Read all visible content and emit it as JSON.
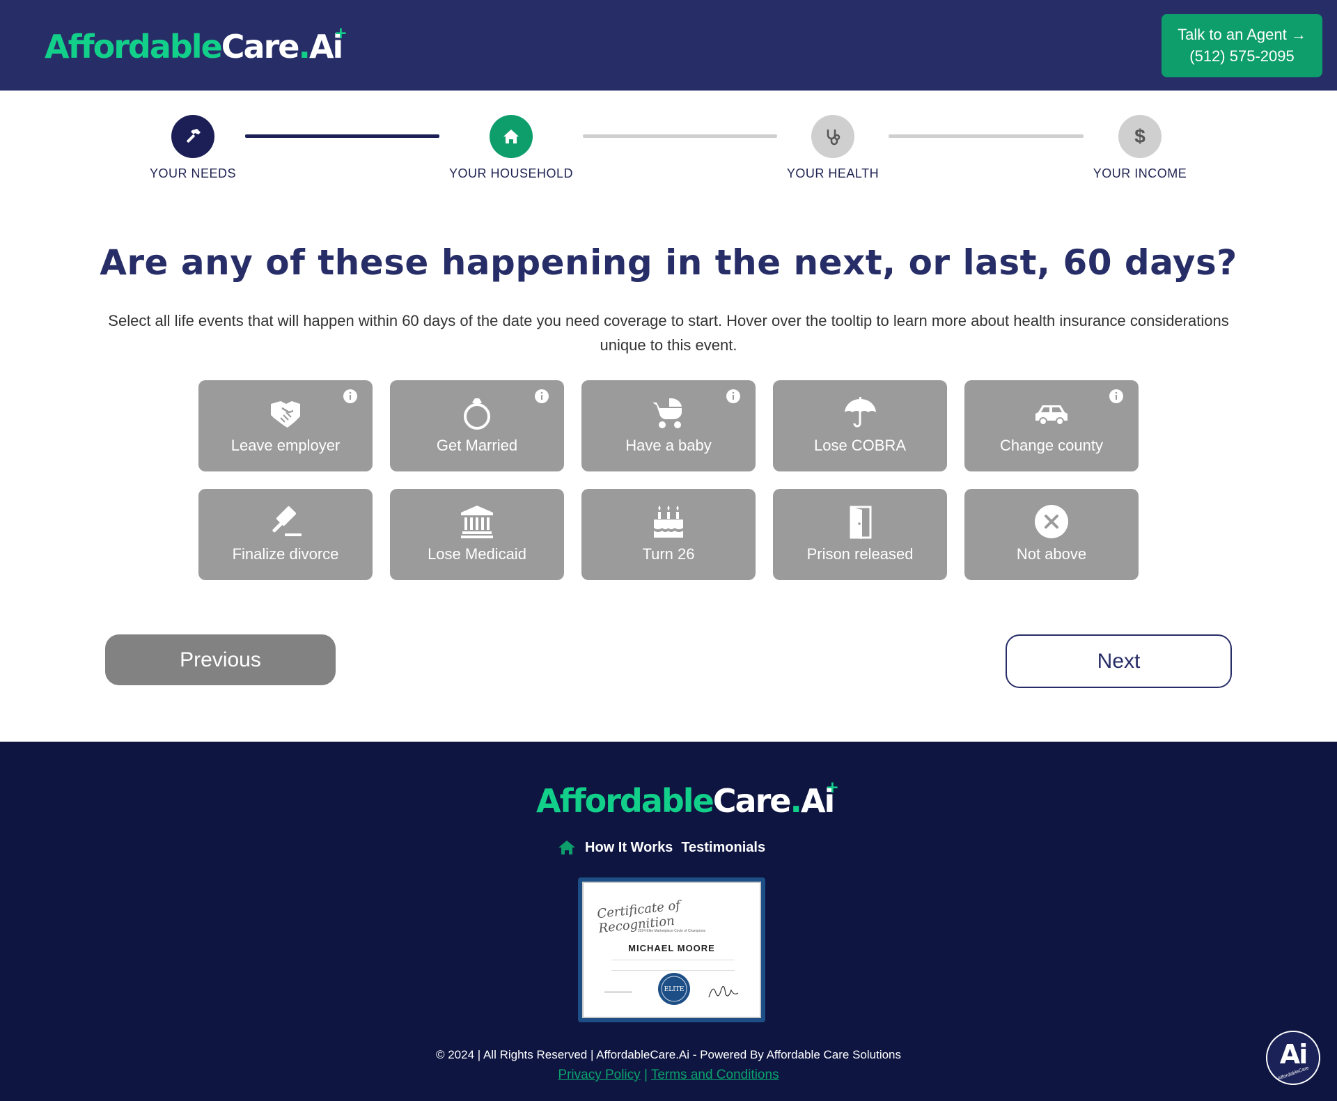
{
  "header": {
    "logo": {
      "part1": "Affordable",
      "part2": "Care",
      "dot": ".",
      "ai": "Ai"
    },
    "agent_button": {
      "line1": "Talk to an Agent →",
      "line2": "(512) 575-2095"
    }
  },
  "stepper": {
    "steps": [
      {
        "label": "YOUR NEEDS",
        "icon": "hammer-icon",
        "state": "completed"
      },
      {
        "label": "YOUR HOUSEHOLD",
        "icon": "home-icon",
        "state": "current"
      },
      {
        "label": "YOUR HEALTH",
        "icon": "stethoscope-icon",
        "state": "upcoming"
      },
      {
        "label": "YOUR INCOME",
        "icon": "dollar-icon",
        "state": "upcoming"
      }
    ]
  },
  "main": {
    "title": "Are any of these happening in the next, or last, 60 days?",
    "subtitle": "Select all life events that will happen within 60 days of the date you need coverage to start. Hover over the tooltip to learn more about health insurance considerations unique to this event.",
    "events": [
      {
        "label": "Leave employer",
        "icon": "handshake-icon",
        "has_info": true
      },
      {
        "label": "Get Married",
        "icon": "ring-icon",
        "has_info": true
      },
      {
        "label": "Have a baby",
        "icon": "baby-carriage-icon",
        "has_info": true
      },
      {
        "label": "Lose COBRA",
        "icon": "umbrella-icon",
        "has_info": false
      },
      {
        "label": "Change county",
        "icon": "car-icon",
        "has_info": true
      },
      {
        "label": "Finalize divorce",
        "icon": "gavel-icon",
        "has_info": false
      },
      {
        "label": "Lose Medicaid",
        "icon": "bank-icon",
        "has_info": false
      },
      {
        "label": "Turn 26",
        "icon": "birthday-cake-icon",
        "has_info": false
      },
      {
        "label": "Prison released",
        "icon": "door-icon",
        "has_info": false
      },
      {
        "label": "Not above",
        "icon": "close-circle-icon",
        "has_info": false
      }
    ],
    "previous_label": "Previous",
    "next_label": "Next"
  },
  "footer": {
    "logo": {
      "part1": "Affordable",
      "part2": "Care",
      "dot": ".",
      "ai": "Ai"
    },
    "nav": [
      "How It Works",
      "Testimonials"
    ],
    "certificate": {
      "title": "Certificate of Recognition",
      "subtitle": "2024 Elite Marketplace Circle of Champions",
      "name": "Michael Moore",
      "seal": "ELITE"
    },
    "copyright": "© 2024 | All Rights Reserved | AffordableCare.Ai - Powered By Affordable Care Solutions",
    "privacy": "Privacy Policy",
    "separator": "|",
    "terms": "Terms and Conditions",
    "badge": {
      "text": "Ai",
      "sub": "AffordableCare"
    }
  },
  "colors": {
    "header_bg": "#272d67",
    "brand_green": "#12d08a",
    "button_green": "#0d9e6c",
    "card_gray": "#9b9b9b",
    "footer_bg": "#0e1541"
  }
}
